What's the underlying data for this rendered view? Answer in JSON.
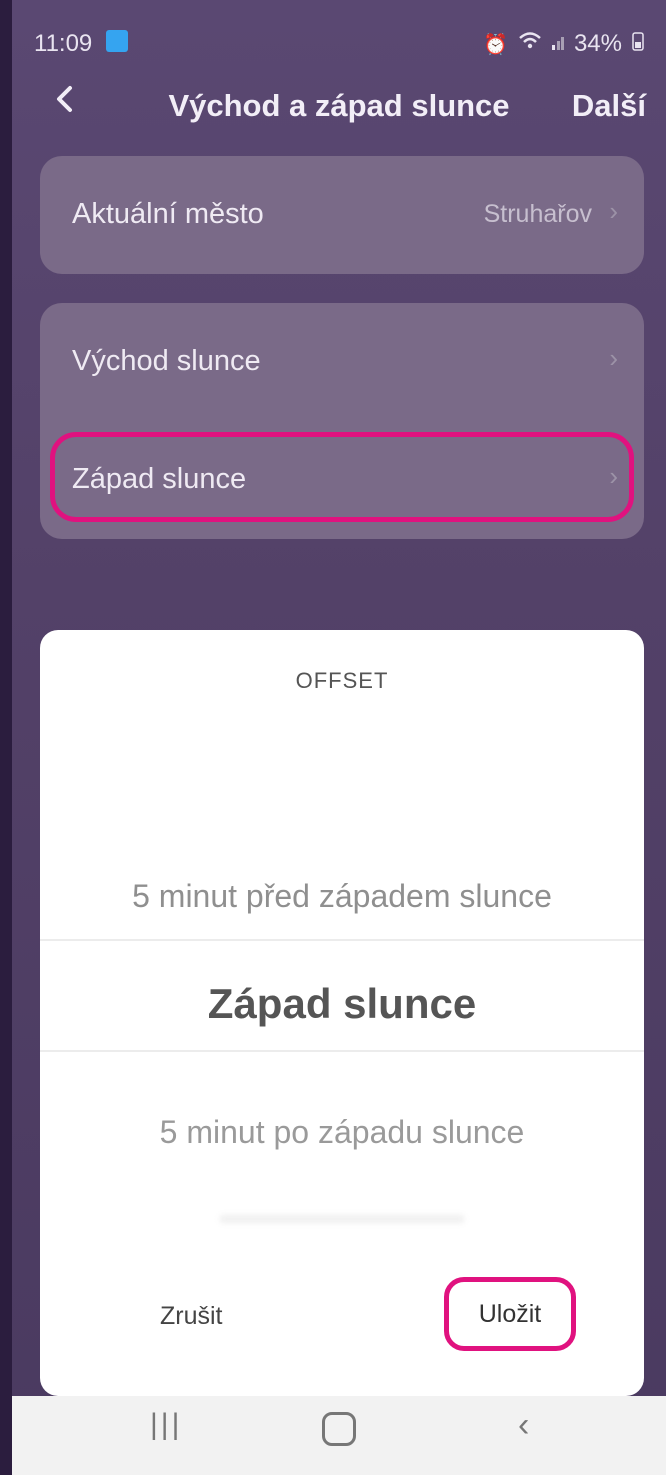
{
  "status_bar": {
    "time": "11:09",
    "battery": "34%",
    "icons": [
      "alarm-icon",
      "wifi-icon",
      "signal-icon",
      "battery-icon"
    ]
  },
  "header": {
    "title": "Východ a západ slunce",
    "next_label": "Další"
  },
  "location": {
    "label": "Aktuální město",
    "value": "Struhařov"
  },
  "events": [
    {
      "label": "Východ slunce"
    },
    {
      "label": "Západ slunce"
    }
  ],
  "sheet": {
    "title": "OFFSET",
    "prev_option": "5 minut před západem slunce",
    "selected_option": "Západ slunce",
    "next_option": "5 minut po západu slunce",
    "cancel_label": "Zrušit",
    "save_label": "Uložit"
  },
  "colors": {
    "highlight": "#e0127f",
    "background": "#533f6b"
  }
}
